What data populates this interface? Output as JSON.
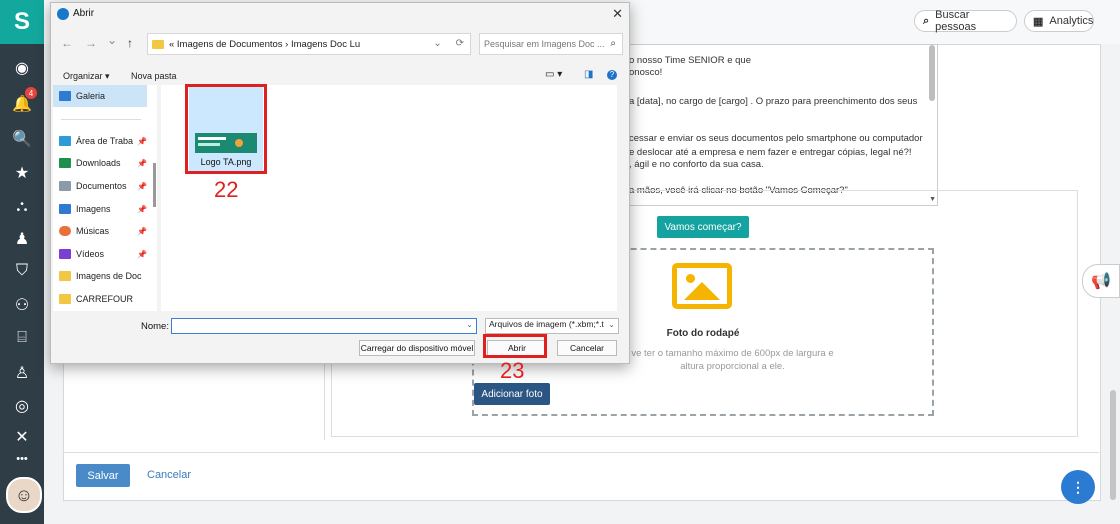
{
  "sidebar": {
    "logo": "S",
    "icons": [
      {
        "name": "profile-icon",
        "glyph": "◉"
      },
      {
        "name": "notification-icon",
        "glyph": "🔔",
        "badge": "4"
      },
      {
        "name": "search-icon",
        "glyph": "🔍"
      },
      {
        "name": "star-icon",
        "glyph": "★"
      },
      {
        "name": "org-chart-icon",
        "glyph": "⛬"
      },
      {
        "name": "people-icon",
        "glyph": "♟"
      },
      {
        "name": "shield-icon",
        "glyph": "⛉"
      },
      {
        "name": "group-icon",
        "glyph": "⚇"
      },
      {
        "name": "briefcase-icon",
        "glyph": "⌸"
      },
      {
        "name": "user-icon",
        "glyph": "♙"
      },
      {
        "name": "target-icon",
        "glyph": "◎"
      },
      {
        "name": "x-icon",
        "glyph": "✕"
      },
      {
        "name": "more-icon",
        "glyph": "•••"
      }
    ]
  },
  "header": {
    "search_people": "Buscar pessoas",
    "analytics": "Analytics"
  },
  "text_panel": {
    "lines": [
      "o nosso Time SENIOR e que",
      "onosco!",
      "a [data], no cargo de [cargo] . O prazo para preenchimento dos seus",
      "cessar e enviar os seus documentos pelo smartphone ou computador",
      "e deslocar até a empresa e nem fazer e entregar cópias, legal né?!",
      ", ágil e no conforto da sua casa.",
      "a mãos, você irá clicar no botão \"Vamos Começar?\""
    ]
  },
  "start_button": "Vamos começar?",
  "footer_photo": {
    "title": "Foto do rodapé",
    "desc_line1": "ve ter o tamanho máximo de 600px de largura e",
    "desc_line2": "altura proporcional a ele.",
    "add_button": "Adicionar foto"
  },
  "form_actions": {
    "save": "Salvar",
    "cancel": "Cancelar"
  },
  "fab_glyph": "⋮",
  "megaphone_glyph": "📢",
  "dialog": {
    "title": "Abrir",
    "close": "✕",
    "nav": {
      "back": "←",
      "forward": "→",
      "down": "⌄",
      "up": "↑"
    },
    "address": "« Imagens de Documentos › Imagens Doc Lu",
    "address_dropdown": "⌄",
    "refresh": "⟳",
    "search_placeholder": "Pesquisar em Imagens Doc ...",
    "organize": "Organizar ▾",
    "new_folder": "Nova pasta",
    "left_pane": [
      {
        "label": "Galeria",
        "color": "#2f7bd1",
        "pinned": false
      },
      {
        "label": "Área de Traba",
        "color": "#2f9ad8",
        "pinned": true
      },
      {
        "label": "Downloads",
        "color": "#1f8f4f",
        "pinned": true
      },
      {
        "label": "Documentos",
        "color": "#8a9aa8",
        "pinned": true
      },
      {
        "label": "Imagens",
        "color": "#2f7bd1",
        "pinned": true
      },
      {
        "label": "Músicas",
        "color": "#e8713a",
        "pinned": true
      },
      {
        "label": "Vídeos",
        "color": "#7b3fd1",
        "pinned": true
      },
      {
        "label": "Imagens de Doc",
        "color": "#f2c744",
        "pinned": false
      },
      {
        "label": "CARREFOUR",
        "color": "#f2c744",
        "pinned": false
      }
    ],
    "file": {
      "name": "Logo TA.png"
    },
    "name_label": "Nome:",
    "name_value": "",
    "file_type": "Arquivos de imagem (*.xbm;*.t",
    "upload_device": "Carregar do dispositivo móvel",
    "open": "Abrir",
    "cancel": "Cancelar"
  },
  "annotations": {
    "step_file": "22",
    "step_open": "23",
    "color": "#e02020"
  }
}
